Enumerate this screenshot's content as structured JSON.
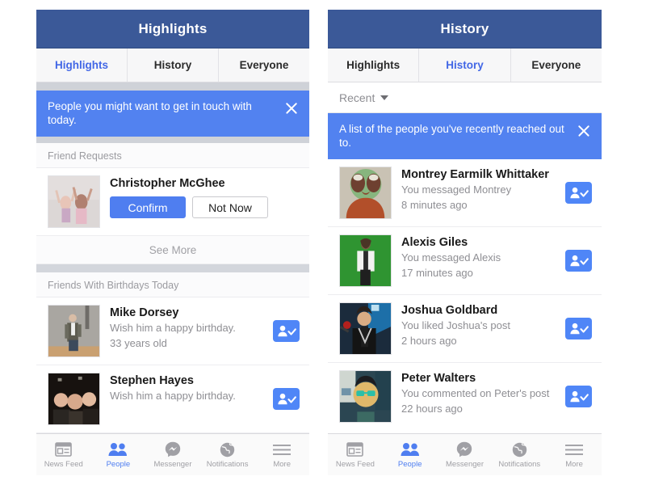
{
  "left_phone": {
    "navbar": {
      "title": "Highlights"
    },
    "tabs": [
      {
        "label": "Highlights",
        "active": true
      },
      {
        "label": "History",
        "active": false
      },
      {
        "label": "Everyone",
        "active": false
      }
    ],
    "banner": {
      "text": "People you might want to get in touch with today.",
      "close_icon": "close-icon",
      "color": "#5282f0"
    },
    "friend_requests": {
      "section_title": "Friend Requests",
      "items": [
        {
          "name": "Christopher McGhee",
          "confirm_label": "Confirm",
          "not_now_label": "Not Now",
          "avatar": "photo-two-children-arms-raised"
        }
      ],
      "see_more_label": "See More"
    },
    "birthdays": {
      "section_title": "Friends With Birthdays Today",
      "items": [
        {
          "name": "Mike Dorsey",
          "line2": "Wish him a happy birthday.",
          "line3": "33 years old",
          "avatar": "photo-man-standing-gray-wall",
          "action_icon": "add-friend-icon"
        },
        {
          "name": "Stephen Hayes",
          "line2": "Wish him a happy birthday.",
          "line3": "",
          "avatar": "photo-group-dark",
          "action_icon": "add-friend-icon"
        }
      ]
    },
    "bottom_tabs": [
      {
        "label": "News Feed",
        "icon": "news-feed-icon",
        "active": false
      },
      {
        "label": "People",
        "icon": "people-icon",
        "active": true
      },
      {
        "label": "Messenger",
        "icon": "messenger-icon",
        "active": false
      },
      {
        "label": "Notifications",
        "icon": "globe-icon",
        "active": false
      },
      {
        "label": "More",
        "icon": "hamburger-icon",
        "active": false
      }
    ]
  },
  "right_phone": {
    "navbar": {
      "title": "History"
    },
    "tabs": [
      {
        "label": "Highlights",
        "active": false
      },
      {
        "label": "History",
        "active": true
      },
      {
        "label": "Everyone",
        "active": false
      }
    ],
    "sort": {
      "label": "Recent",
      "caret_icon": "chevron-down-icon"
    },
    "banner": {
      "text": "A list of the people you've recently reached out to.",
      "close_icon": "close-icon",
      "color": "#5282f0"
    },
    "history_items": [
      {
        "name": "Montrey Earmilk Whittaker",
        "line2": "You messaged Montrey",
        "line3": "8 minutes ago",
        "avatar": "photo-figure-green-circle",
        "action_icon": "add-friend-icon"
      },
      {
        "name": "Alexis Giles",
        "line2": "You messaged Alexis",
        "line3": "17 minutes ago",
        "avatar": "photo-woman-white-jacket-green-bg",
        "action_icon": "add-friend-icon"
      },
      {
        "name": "Joshua Goldbard",
        "line2": "You liked Joshua's post",
        "line3": "2 hours ago",
        "avatar": "photo-man-microphone-blue-bg",
        "action_icon": "add-friend-icon"
      },
      {
        "name": "Peter Walters",
        "line2": "You commented on Peter's post",
        "line3": "22 hours ago",
        "avatar": "photo-man-sunglasses-selfie",
        "action_icon": "add-friend-icon"
      }
    ],
    "bottom_tabs": [
      {
        "label": "News Feed",
        "icon": "news-feed-icon",
        "active": false
      },
      {
        "label": "People",
        "icon": "people-icon",
        "active": true
      },
      {
        "label": "Messenger",
        "icon": "messenger-icon",
        "active": false
      },
      {
        "label": "Notifications",
        "icon": "globe-icon",
        "active": false
      },
      {
        "label": "More",
        "icon": "hamburger-icon",
        "active": false
      }
    ]
  },
  "theme": {
    "navbar_blue": "#3b5998",
    "banner_blue": "#5282f0",
    "accent_blue": "#4267e6",
    "action_blue": "#4f86f7",
    "page_bg": "#ffffff"
  }
}
